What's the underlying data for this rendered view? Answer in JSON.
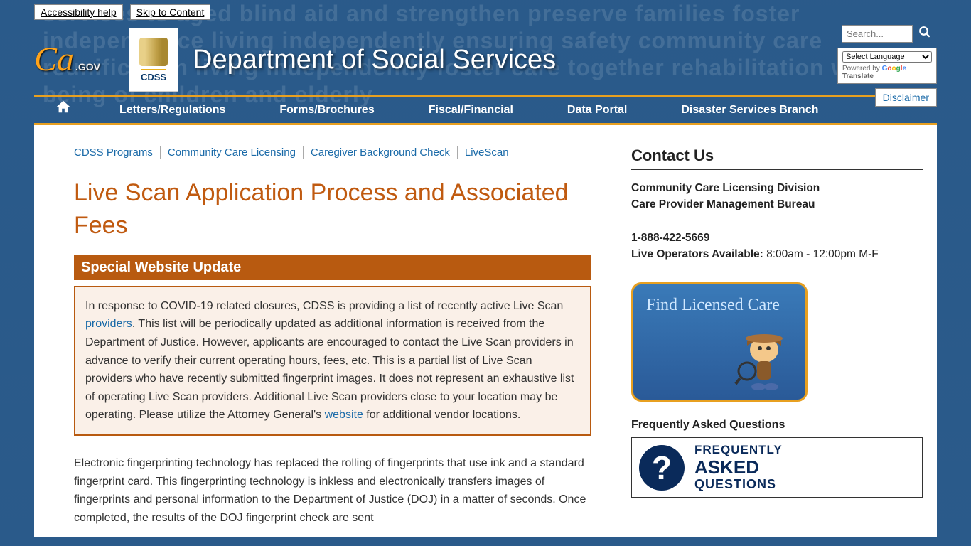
{
  "bg_words": "services to aged blind aid and strengthen preserve families foster independence living independently ensuring safety community care reunification living independently foster care together rehabilitation well-being of children and elderly",
  "skip": {
    "accessibility": "Accessibility help",
    "content": "Skip to Content"
  },
  "header": {
    "ca": "Ca",
    "gov": ".GOV",
    "cdss_label": "CDSS",
    "title": "Department of Social Services",
    "search_placeholder": "Search...",
    "language_select": "Select Language",
    "powered_by": "Powered by ",
    "translate_word": " Translate",
    "disclaimer": "Disclaimer"
  },
  "nav": {
    "items": [
      "Letters/Regulations",
      "Forms/Brochures",
      "Fiscal/Financial",
      "Data Portal",
      "Disaster Services Branch"
    ]
  },
  "breadcrumb": [
    "CDSS Programs",
    "Community Care Licensing",
    "Caregiver Background Check",
    "LiveScan"
  ],
  "main": {
    "title": "Live Scan Application Process and Associated Fees",
    "update_header": "Special Website Update",
    "update_p1": "In response to COVID-19 related closures, CDSS is providing a list of recently active Live Scan ",
    "update_link1": "providers",
    "update_p2": ". This list will be periodically updated as additional information is received from the Department of Justice. However, applicants are encouraged to contact the Live Scan providers in advance to verify their current operating hours, fees, etc. This is a partial list of Live Scan providers who have recently submitted fingerprint images. It does not represent an exhaustive list of operating Live Scan providers. Additional Live Scan providers close to your location may be operating. Please utilize the Attorney General's ",
    "update_link2": "website",
    "update_p3": " for additional vendor locations.",
    "body": "Electronic fingerprinting technology has replaced the rolling of fingerprints that use ink and a standard fingerprint card. This fingerprinting technology is inkless and electronically transfers images of fingerprints and personal information to the Department of Justice (DOJ) in a matter of seconds. Once completed, the results of the DOJ fingerprint check are sent"
  },
  "sidebar": {
    "contact_heading": "Contact Us",
    "div1": "Community Care Licensing Division",
    "div2": "Care Provider Management Bureau",
    "phone": "1-888-422-5669",
    "hours_label": "Live Operators Available: ",
    "hours_value": "8:00am - 12:00pm M-F",
    "find_care": "Find Licensed Care",
    "faq_label": "Frequently Asked Questions",
    "faq_l1": "FREQUENTLY",
    "faq_l2": "ASKED",
    "faq_l3": "QUESTIONS"
  }
}
